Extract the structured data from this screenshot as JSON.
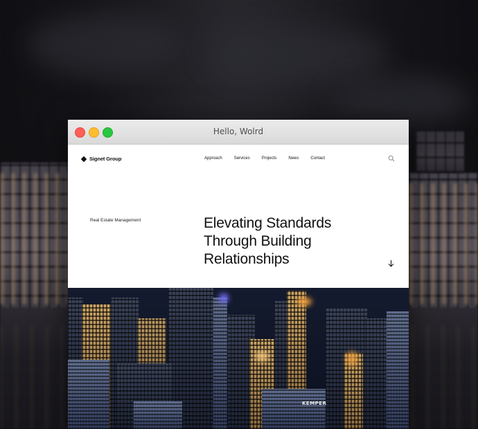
{
  "window": {
    "title": "Hello, Wolrd"
  },
  "site": {
    "brand": "Signet Group",
    "nav": [
      {
        "label": "Approach"
      },
      {
        "label": "Services"
      },
      {
        "label": "Projects"
      },
      {
        "label": "News"
      },
      {
        "label": "Contact"
      }
    ],
    "kicker": "Real Estate Management",
    "headline": "Elevating Standards Through Building Relationships",
    "hero_sign": "KEMPER"
  },
  "colors": {
    "close": "#fe5f57",
    "minimize": "#febc2e",
    "zoom": "#28c840",
    "text": "#111111"
  }
}
